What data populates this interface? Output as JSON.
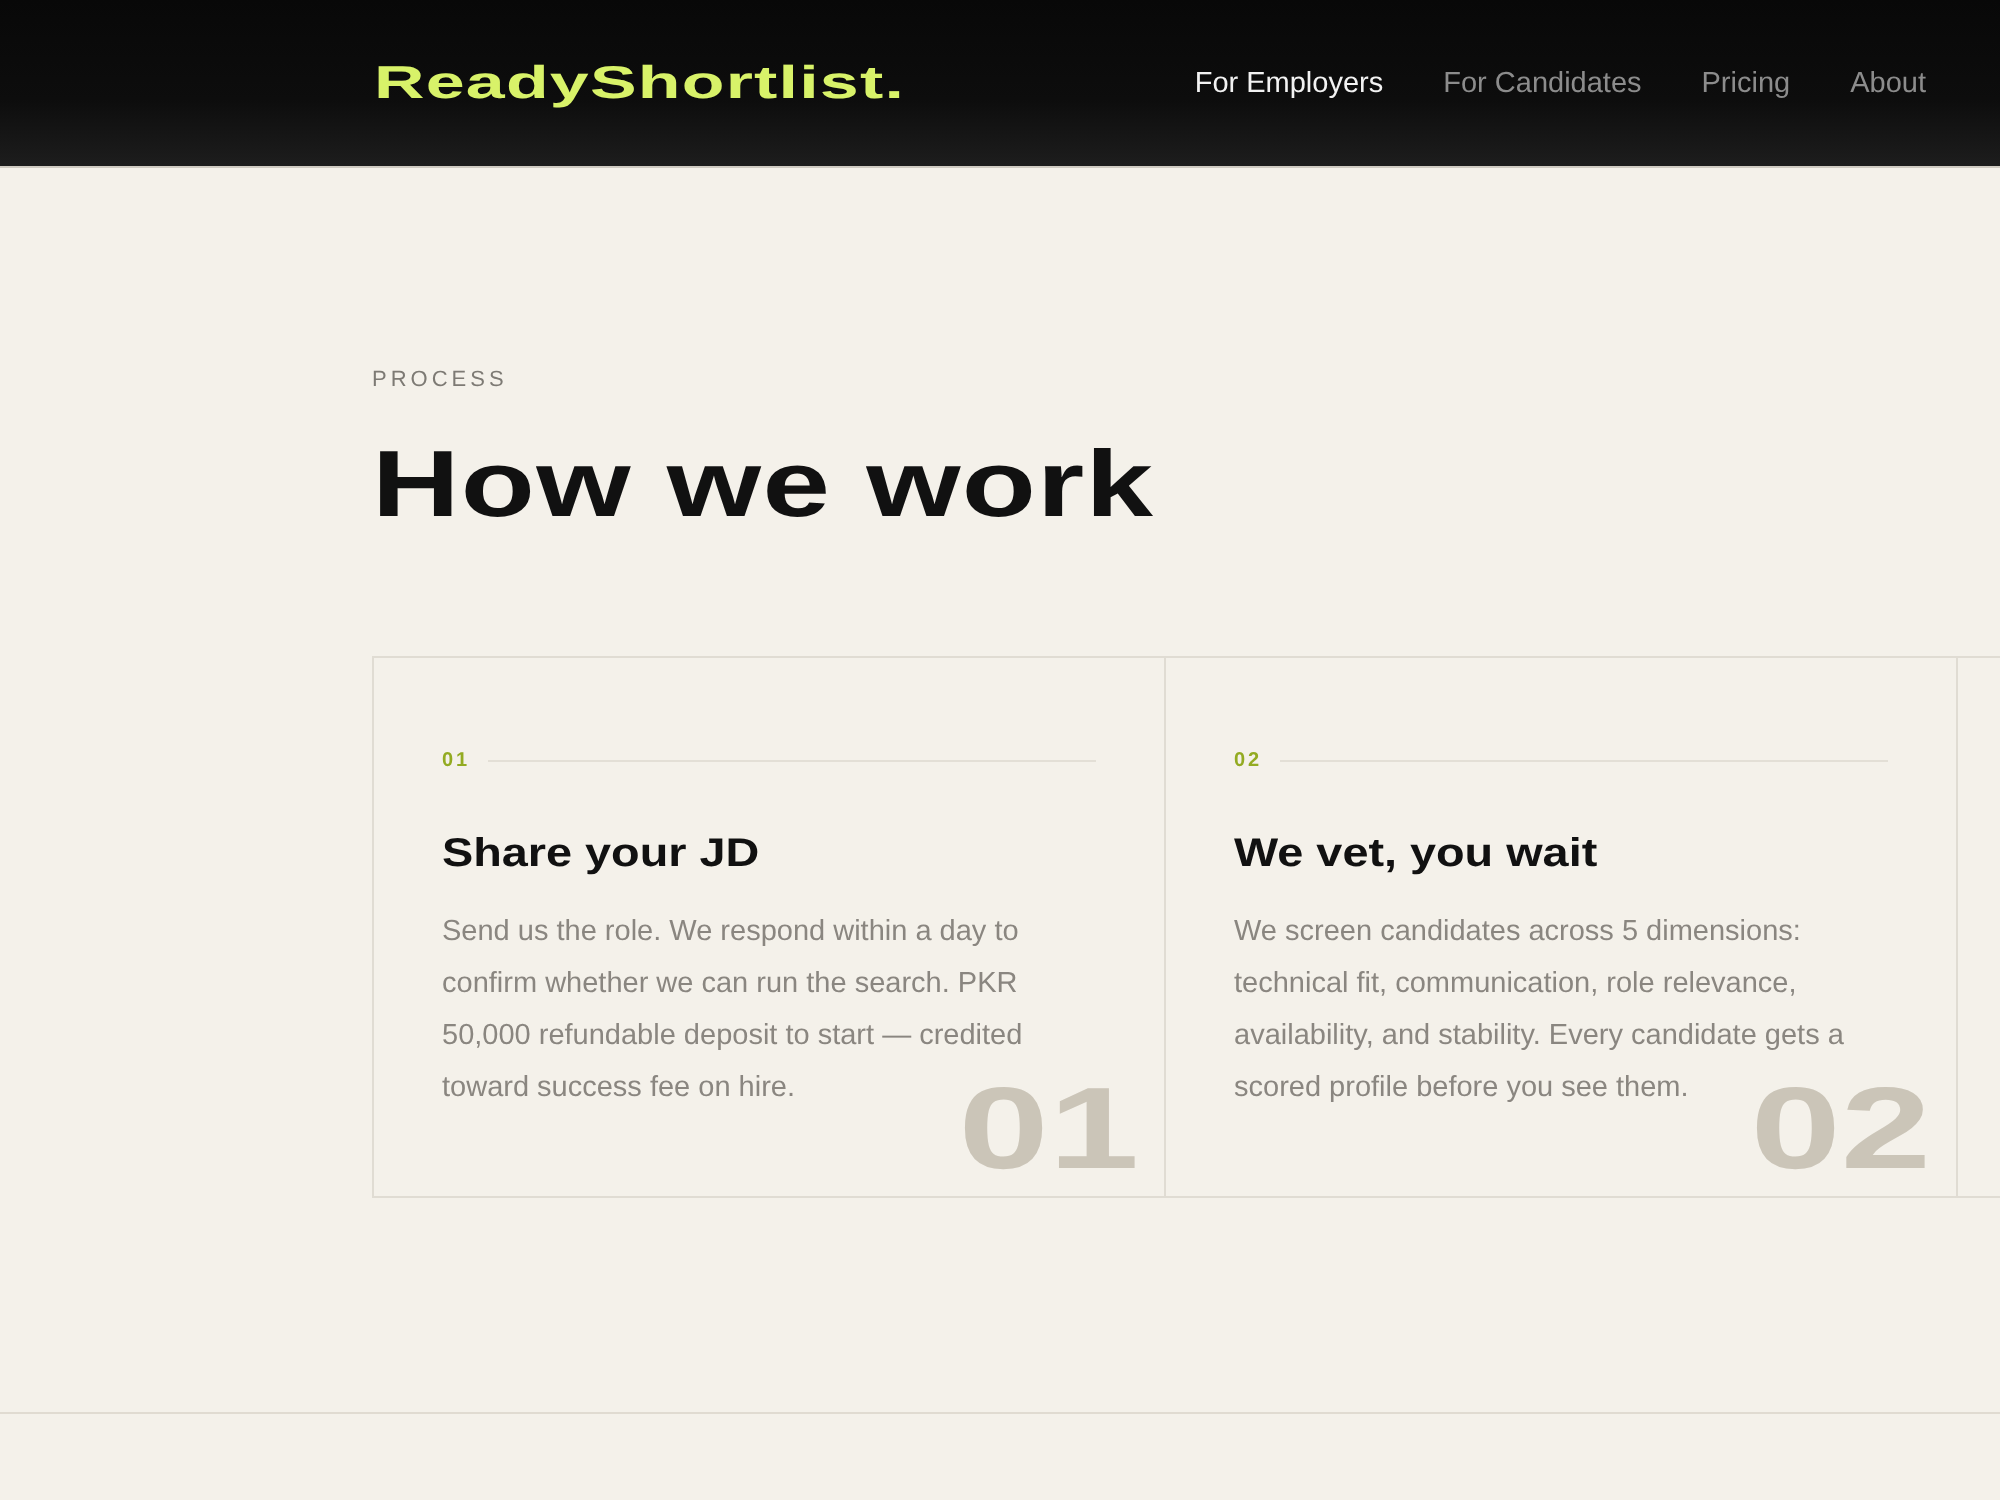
{
  "header": {
    "logo": "ReadyShortlist.",
    "nav": [
      {
        "label": "For Employers",
        "selected": true
      },
      {
        "label": "For Candidates",
        "selected": false
      },
      {
        "label": "Pricing",
        "selected": false
      },
      {
        "label": "About",
        "selected": false
      }
    ]
  },
  "section": {
    "eyebrow": "PROCESS",
    "heading": "How we work",
    "steps": [
      {
        "number": "01",
        "title": "Share your JD",
        "description": "Send us the role. We respond within a day to confirm whether we can run the search. PKR 50,000 refundable deposit to start — credited toward success fee on hire.",
        "watermark": "01"
      },
      {
        "number": "02",
        "title": "We vet, you wait",
        "description": "We screen candidates across 5 dimensions: technical fit, communication, role relevance, availability, and stability. Every candidate gets a scored profile before you see them.",
        "watermark": "02"
      }
    ]
  }
}
